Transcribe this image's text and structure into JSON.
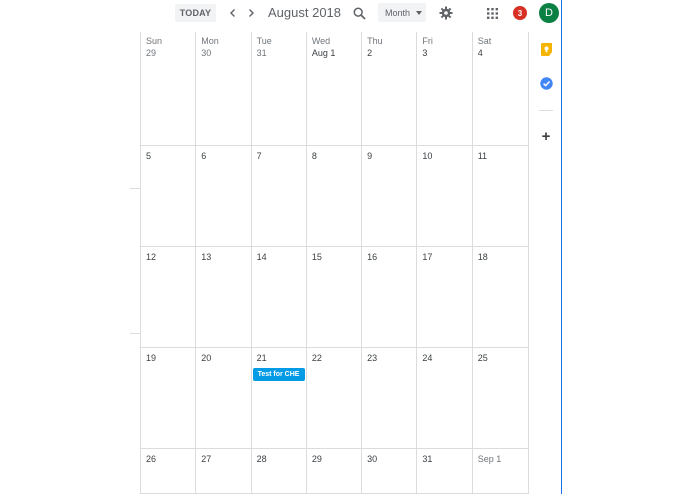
{
  "header": {
    "today_label": "TODAY",
    "prev_icon": "chevron-left-icon",
    "next_icon": "chevron-right-icon",
    "period_title": "August 2018",
    "search_icon": "search-icon",
    "view_label": "Month",
    "settings_icon": "gear-icon",
    "apps_icon": "apps-grid-icon",
    "notification_count": "3",
    "avatar_initial": "D"
  },
  "calendar": {
    "weekdays": [
      "Sun",
      "Mon",
      "Tue",
      "Wed",
      "Thu",
      "Fri",
      "Sat"
    ],
    "weeks": [
      [
        "29",
        "30",
        "31",
        "Aug 1",
        "2",
        "3",
        "4"
      ],
      [
        "5",
        "6",
        "7",
        "8",
        "9",
        "10",
        "11"
      ],
      [
        "12",
        "13",
        "14",
        "15",
        "16",
        "17",
        "18"
      ],
      [
        "19",
        "20",
        "21",
        "22",
        "23",
        "24",
        "25"
      ],
      [
        "26",
        "27",
        "28",
        "29",
        "30",
        "31",
        "Sep 1"
      ]
    ],
    "events": [
      {
        "title": "Test for CHE",
        "color": "#039be5"
      }
    ]
  },
  "side_panel": {
    "keep_icon": "keep-icon",
    "tasks_icon": "tasks-icon",
    "add_label": "+"
  },
  "colors": {
    "accent": "#1a73e8",
    "event": "#039be5",
    "badge": "#d93025",
    "avatar": "#0b8043"
  }
}
